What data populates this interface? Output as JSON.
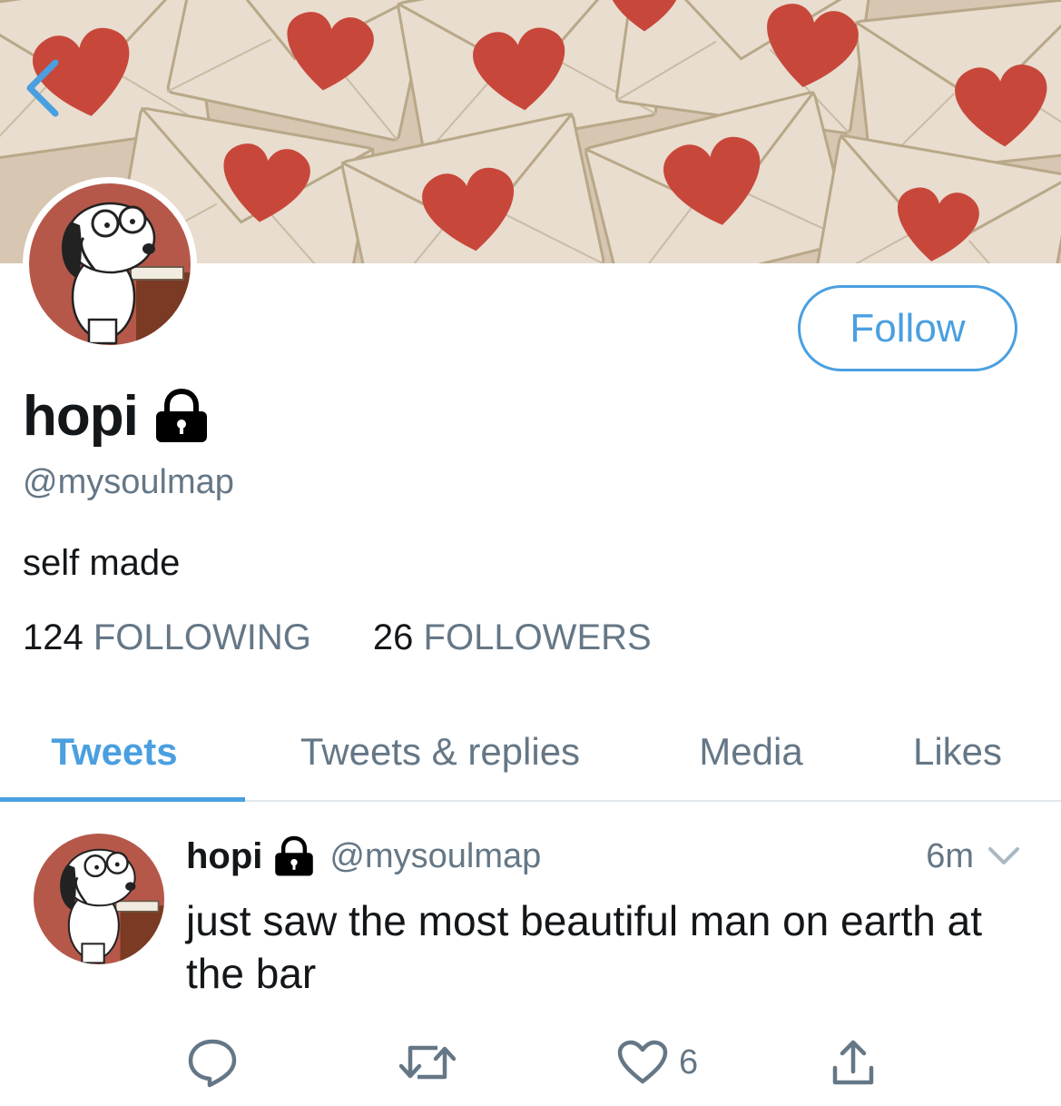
{
  "header": {
    "back_icon": "chevron-left-icon",
    "banner_image": "envelopes-with-red-hearts"
  },
  "profile": {
    "display_name": "hopi",
    "protected_icon": "lock-icon",
    "handle": "@mysoulmap",
    "bio": "self made",
    "following_count": "124",
    "following_label": "FOLLOWING",
    "followers_count": "26",
    "followers_label": "FOLLOWERS",
    "follow_button": "Follow"
  },
  "tabs": [
    {
      "label": "Tweets",
      "active": true
    },
    {
      "label": "Tweets & replies",
      "active": false
    },
    {
      "label": "Media",
      "active": false
    },
    {
      "label": "Likes",
      "active": false
    }
  ],
  "tweet": {
    "name": "hopi",
    "handle": "@mysoulmap",
    "time": "6m",
    "text": "just saw the most beautiful man on earth at the bar",
    "reply_count": "",
    "retweet_count": "",
    "like_count": "6"
  },
  "colors": {
    "accent": "#4a9fe0",
    "secondary_text": "#657786",
    "primary_text": "#14171a",
    "heart_red": "#c8473b",
    "envelope": "#e6dccd"
  }
}
